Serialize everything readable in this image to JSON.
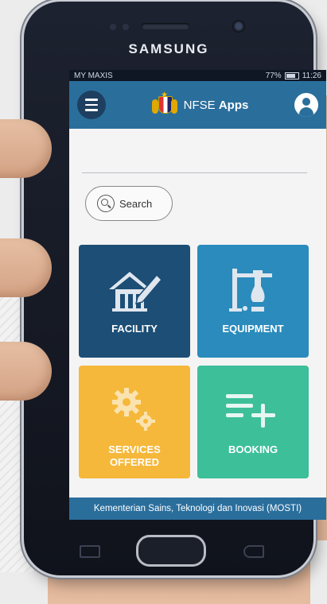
{
  "device": {
    "brand": "SAMSUNG"
  },
  "status_bar": {
    "carrier": "MY MAXIS",
    "battery": "77%",
    "time": "11:26"
  },
  "app_bar": {
    "title_prefix": "NFSE",
    "title_bold": "Apps",
    "menu_icon": "hamburger-icon",
    "profile_icon": "account-icon"
  },
  "search": {
    "label": "Search",
    "icon": "search-icon"
  },
  "tiles": [
    {
      "label": "FACILITY",
      "icon": "building-pencil-icon",
      "color": "#1c4e76"
    },
    {
      "label": "EQUIPMENT",
      "icon": "lab-equipment-icon",
      "color": "#2a8bbc"
    },
    {
      "label": "SERVICES OFFERED",
      "icon": "gears-icon",
      "color": "#f5b83a"
    },
    {
      "label": "BOOKING",
      "icon": "playlist-add-icon",
      "color": "#3dbf9a"
    }
  ],
  "footer": {
    "text": "Kementerian Sains, Teknologi dan Inovasi (MOSTI)"
  },
  "colors": {
    "primary": "#2a6e9c",
    "background": "#f4f4f4"
  }
}
